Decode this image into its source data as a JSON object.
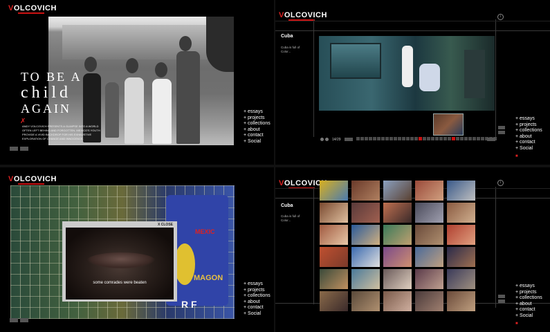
{
  "brand": {
    "logo_text": "VOLCOVICH",
    "logo_first": "V",
    "logo_rest": "OLCOVICH"
  },
  "menu": [
    "+ essays",
    "+ projects",
    "+ collections",
    "+ about",
    "+ contact",
    "+ Social"
  ],
  "panel1": {
    "title_line1": "TO BE A",
    "title_line2": "child",
    "title_line3": "AGAIN",
    "blurb": "Andy Volcovich presents a glimpse into a world often left behind and forgotten. Mexico's youth provide a vivid backdrop for his exhaustive exploration of change and innocence."
  },
  "panel2": {
    "section_title": "Cuba",
    "section_desc": "Cuba is full of Color...",
    "counter": "14/29",
    "strip_count": 34,
    "strip_active": [
      15,
      23
    ]
  },
  "panel3": {
    "close_label": "X CLOSE",
    "caption": "some comrades were beaten",
    "sign_text_1": "MEXIC",
    "sign_text_2": "MAGON",
    "sign_text_3": "R F"
  },
  "panel4": {
    "section_title": "Cuba",
    "section_desc": "Cuba is full of Color..."
  },
  "colors": {
    "accent": "#cc1111",
    "background": "#000000"
  },
  "icons": {
    "info": "info-icon",
    "mark": "x-mark-icon"
  }
}
